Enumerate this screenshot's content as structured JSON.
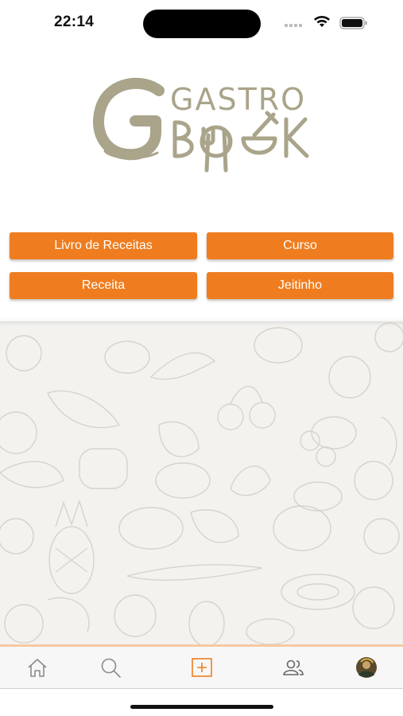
{
  "status_bar": {
    "time": "22:14"
  },
  "logo": {
    "line1": "GASTRO",
    "line2": "BOOK",
    "alt": "Gastro Book"
  },
  "menu_buttons": [
    {
      "label": "Livro de Receitas"
    },
    {
      "label": "Curso"
    },
    {
      "label": "Receita"
    },
    {
      "label": "Jeitinho"
    }
  ],
  "tabbar": {
    "items": [
      {
        "icon": "home-icon"
      },
      {
        "icon": "search-icon"
      },
      {
        "icon": "add-icon",
        "active": true
      },
      {
        "icon": "people-icon"
      },
      {
        "icon": "profile-avatar"
      }
    ]
  },
  "colors": {
    "accent": "#ef7d1f",
    "logo": "#a9a48a",
    "pattern_bg": "#f3f2ef"
  }
}
